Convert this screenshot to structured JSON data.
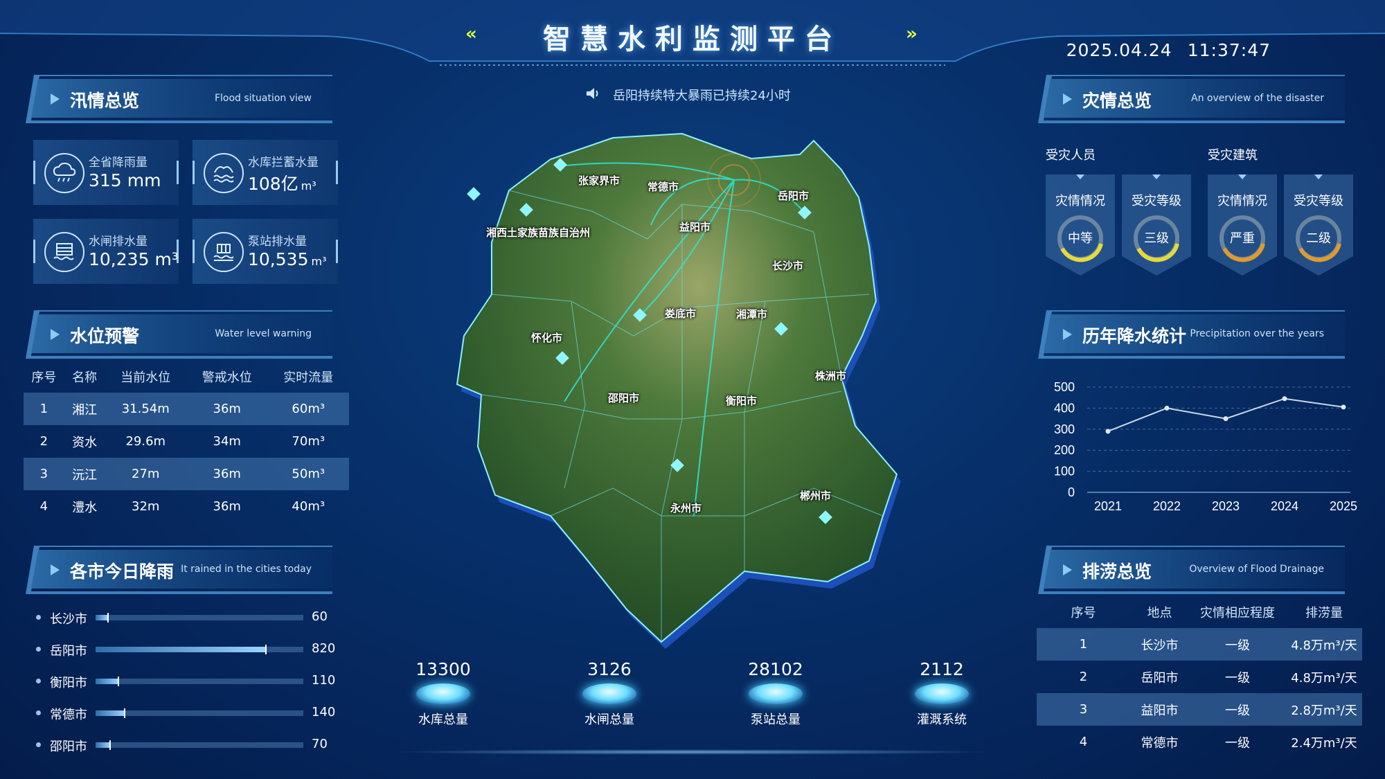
{
  "header": {
    "title": "智慧水利监测平台",
    "left_chevron": "«",
    "right_chevron": "»",
    "date": "2025.04.24",
    "time": "11:37:47"
  },
  "flood": {
    "title_cn": "汛情总览",
    "title_en": "Flood situation view",
    "cards": [
      {
        "label": "全省降雨量",
        "value": "315",
        "unit": "mm",
        "icon": "rain-cloud-icon"
      },
      {
        "label": "水库拦蓄水量",
        "value": "108亿",
        "unit": "m³",
        "icon": "reservoir-icon"
      },
      {
        "label": "水闸排水量",
        "value": "10,235",
        "unit": "m³",
        "icon": "sluice-gate-icon"
      },
      {
        "label": "泵站排水量",
        "value": "10,535",
        "unit": "m³",
        "icon": "pump-station-icon"
      }
    ]
  },
  "water_level": {
    "title_cn": "水位预警",
    "title_en": "Water level warning",
    "headers": [
      "序号",
      "名称",
      "当前水位",
      "警戒水位",
      "实时流量"
    ],
    "rows": [
      [
        "1",
        "湘江",
        "31.54m",
        "36m",
        "60m³"
      ],
      [
        "2",
        "资水",
        "29.6m",
        "34m",
        "70m³"
      ],
      [
        "3",
        "沅江",
        "27m",
        "36m",
        "50m³"
      ],
      [
        "4",
        "澧水",
        "32m",
        "36m",
        "40m³"
      ]
    ]
  },
  "city_rain": {
    "title_cn": "各市今日降雨",
    "title_en": "It rained in the cities today",
    "max": 1000,
    "items": [
      {
        "name": "长沙市",
        "value": "60"
      },
      {
        "name": "岳阳市",
        "value": "820"
      },
      {
        "name": "衡阳市",
        "value": "110"
      },
      {
        "name": "常德市",
        "value": "140"
      },
      {
        "name": "邵阳市",
        "value": "70"
      }
    ]
  },
  "notice": "岳阳持续特大暴雨已持续24小时",
  "map": {
    "labels": [
      "张家界市",
      "常德市",
      "岳阳市",
      "益阳市",
      "湘西土家族苗族自治州",
      "长沙市",
      "娄底市",
      "湘潭市",
      "怀化市",
      "株洲市",
      "邵阳市",
      "衡阳市",
      "郴州市",
      "永州市"
    ]
  },
  "center_stats": [
    {
      "value": "13300",
      "label": "水库总量"
    },
    {
      "value": "3126",
      "label": "水闸总量"
    },
    {
      "value": "28102",
      "label": "泵站总量"
    },
    {
      "value": "2112",
      "label": "灌溉系统"
    }
  ],
  "disaster": {
    "title_cn": "灾情总览",
    "title_en": "An overview of the disaster",
    "groups": [
      "受灾人员",
      "受灾建筑"
    ],
    "gauges": [
      {
        "title": "灾情情况",
        "level": "中等",
        "color": "#e6d93a"
      },
      {
        "title": "受灾等级",
        "level": "三级",
        "color": "#e6d93a"
      },
      {
        "title": "灾情情况",
        "level": "严重",
        "color": "#e09a2e"
      },
      {
        "title": "受灾等级",
        "level": "二级",
        "color": "#e09a2e"
      }
    ]
  },
  "precip": {
    "title_cn": "历年降水统计",
    "title_en": "Precipitation over the years"
  },
  "chart_data": {
    "type": "line",
    "categories": [
      "2021",
      "2022",
      "2023",
      "2024",
      "2025"
    ],
    "values": [
      290,
      400,
      350,
      445,
      405
    ],
    "yticks": [
      "0",
      "100",
      "200",
      "300",
      "400",
      "500"
    ],
    "ylim": [
      0,
      500
    ],
    "grid": true
  },
  "drainage": {
    "title_cn": "排涝总览",
    "title_en": "Overview of Flood Drainage",
    "headers": [
      "序号",
      "地点",
      "灾情相应程度",
      "排涝量"
    ],
    "rows": [
      [
        "1",
        "长沙市",
        "一级",
        "4.8万m³/天"
      ],
      [
        "2",
        "岳阳市",
        "一级",
        "4.8万m³/天"
      ],
      [
        "3",
        "益阳市",
        "一级",
        "2.8万m³/天"
      ],
      [
        "4",
        "常德市",
        "一级",
        "2.4万m³/天"
      ]
    ]
  }
}
